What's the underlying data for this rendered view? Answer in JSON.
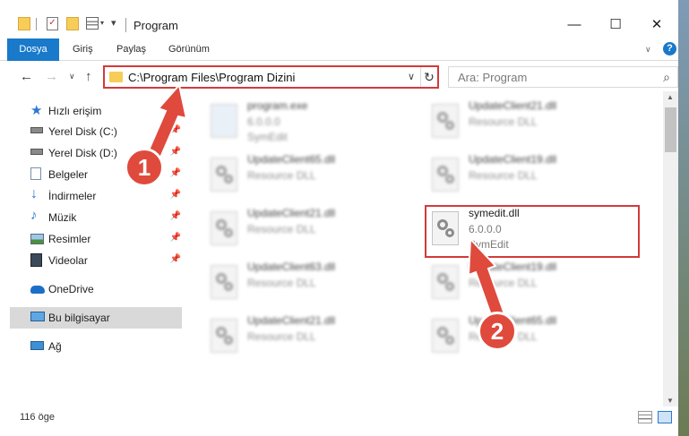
{
  "window": {
    "title": "Program",
    "controls": {
      "minimize": "—",
      "maximize": "☐",
      "close": "✕"
    }
  },
  "ribbon": {
    "tabs": [
      "Dosya",
      "Giriş",
      "Paylaş",
      "Görünüm"
    ],
    "help": "?"
  },
  "address": {
    "path": "C:\\Program Files\\Program Dizini",
    "search_placeholder": "Ara: Program"
  },
  "sidebar": {
    "items": [
      {
        "label": "Hızlı erişim",
        "icon": "star-icon"
      },
      {
        "label": "Yerel Disk (C:)",
        "icon": "drive-icon",
        "pinned": true
      },
      {
        "label": "Yerel Disk (D:)",
        "icon": "drive-icon",
        "pinned": true
      },
      {
        "label": "Belgeler",
        "icon": "documents-icon",
        "pinned": true
      },
      {
        "label": "İndirmeler",
        "icon": "download-icon",
        "pinned": true
      },
      {
        "label": "Müzik",
        "icon": "music-icon",
        "pinned": true
      },
      {
        "label": "Resimler",
        "icon": "pictures-icon",
        "pinned": true
      },
      {
        "label": "Videolar",
        "icon": "videos-icon",
        "pinned": true
      },
      {
        "label": "OneDrive",
        "icon": "cloud-icon"
      },
      {
        "label": "Bu bilgisayar",
        "icon": "computer-icon",
        "selected": true
      },
      {
        "label": "Ağ",
        "icon": "network-icon"
      }
    ]
  },
  "files": [
    {
      "name": "program.exe",
      "line2": "6.0.0.0",
      "line3": "SymEdit"
    },
    {
      "name": "UpdateClient21.dll",
      "line2": "Resource DLL"
    },
    {
      "name": "UpdateClient65.dll",
      "line2": "Resource DLL"
    },
    {
      "name": "UpdateClient19.dll",
      "line2": "Resource DLL"
    },
    {
      "name": "UpdateClient21.dll",
      "line2": "Resource DLL"
    },
    {
      "name": "symedit.dll",
      "line2": "6.0.0.0",
      "line3": "SymEdit",
      "highlighted": true
    },
    {
      "name": "UpdateClient63.dll",
      "line2": "Resource DLL"
    },
    {
      "name": "UpdateClient19.dll",
      "line2": "Resource DLL"
    },
    {
      "name": "UpdateClient21.dll",
      "line2": "Resource DLL"
    },
    {
      "name": "UpdateClient65.dll",
      "line2": "Resource DLL"
    }
  ],
  "status": {
    "item_count": "116 öge"
  },
  "annotations": {
    "step1": "1",
    "step2": "2",
    "color": "#df4a3d"
  }
}
